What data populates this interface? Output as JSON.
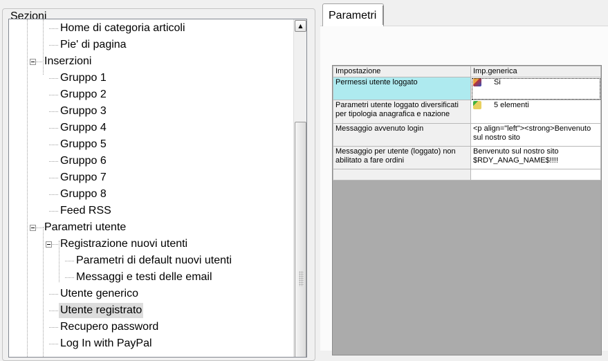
{
  "left": {
    "group_title": "Sezioni",
    "tree": [
      {
        "label": "Home di categoria articoli",
        "level": 2
      },
      {
        "label": "Pie' di pagina",
        "level": 2
      },
      {
        "label": "Inserzioni",
        "level": 1,
        "expanded": true
      },
      {
        "label": "Gruppo 1",
        "level": 2
      },
      {
        "label": "Gruppo 2",
        "level": 2
      },
      {
        "label": "Gruppo 3",
        "level": 2
      },
      {
        "label": "Gruppo 4",
        "level": 2
      },
      {
        "label": "Gruppo 5",
        "level": 2
      },
      {
        "label": "Gruppo 6",
        "level": 2
      },
      {
        "label": "Gruppo 7",
        "level": 2
      },
      {
        "label": "Gruppo 8",
        "level": 2
      },
      {
        "label": "Feed RSS",
        "level": 2
      },
      {
        "label": "Parametri utente",
        "level": 1,
        "expanded": true
      },
      {
        "label": "Registrazione nuovi utenti",
        "level": 2,
        "expanded": true
      },
      {
        "label": "Parametri di default nuovi utenti",
        "level": 3
      },
      {
        "label": "Messaggi e testi delle email",
        "level": 3
      },
      {
        "label": "Utente generico",
        "level": 2
      },
      {
        "label": "Utente registrato",
        "level": 2,
        "selected": true
      },
      {
        "label": "Recupero password",
        "level": 2
      },
      {
        "label": "Log In with PayPal",
        "level": 2
      }
    ]
  },
  "right": {
    "tab": "Parametri",
    "table": {
      "headers": [
        "Impostazione",
        "Imp.generica"
      ],
      "rows": [
        {
          "key": "Permessi utente loggato",
          "value": "Si",
          "icon": "users-icon"
        },
        {
          "key": "Parametri utente loggato diversificati per tipologia anagrafica e nazione",
          "value": "5 elementi",
          "icon": "folder-icon"
        },
        {
          "key": "Messaggio avvenuto login",
          "value": "<p align=\"left\"><strong>Benvenuto sul nostro sito"
        },
        {
          "key": "Messaggio per utente (loggato) non abilitato a fare ordini",
          "value": "Benvenuto sul nostro sito $RDY_ANAG_NAME$!!!!"
        },
        {
          "key": "",
          "value": ""
        }
      ]
    },
    "highlight_color": "#aeeaef"
  }
}
